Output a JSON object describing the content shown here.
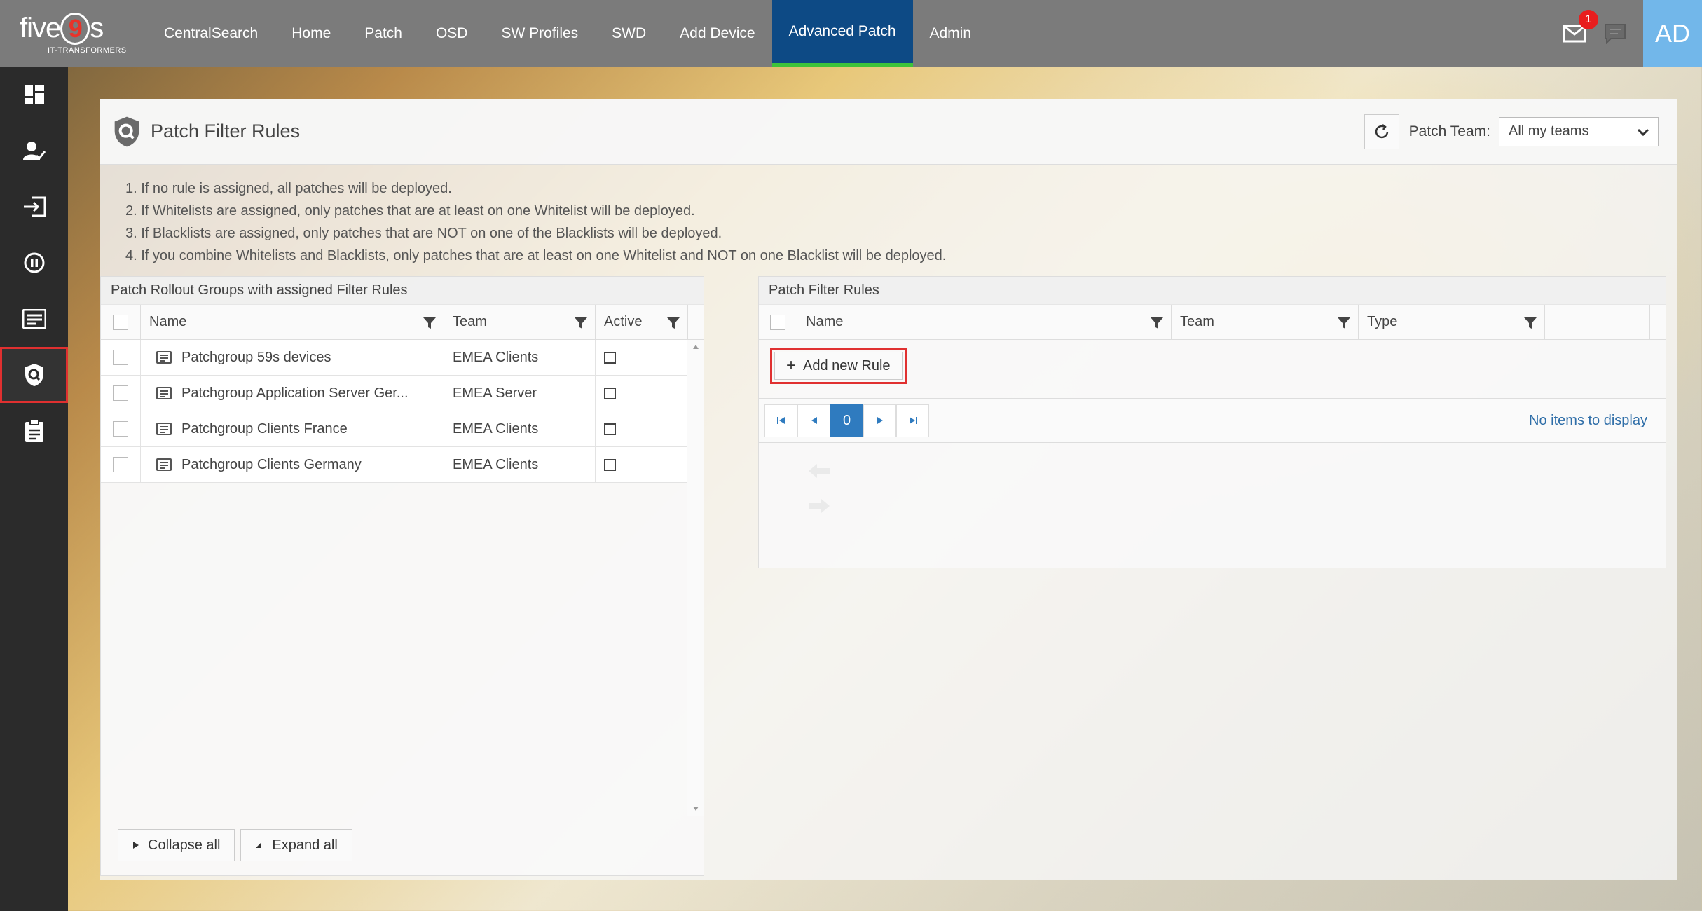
{
  "app": {
    "logo_text": "five",
    "logo_nine": "9",
    "logo_suffix": "s",
    "logo_tagline": "IT-TRANSFORMERS",
    "user_initials": "AD",
    "notification_count": "1"
  },
  "nav": {
    "items": [
      {
        "label": "CentralSearch"
      },
      {
        "label": "Home"
      },
      {
        "label": "Patch"
      },
      {
        "label": "OSD"
      },
      {
        "label": "SW Profiles"
      },
      {
        "label": "SWD"
      },
      {
        "label": "Add Device"
      },
      {
        "label": "Advanced Patch",
        "active": true
      },
      {
        "label": "Admin"
      }
    ]
  },
  "sidebar": {
    "items": [
      {
        "icon": "dashboard-icon"
      },
      {
        "icon": "user-check-icon"
      },
      {
        "icon": "login-icon"
      },
      {
        "icon": "pause-circle-icon"
      },
      {
        "icon": "list-icon"
      },
      {
        "icon": "shield-search-icon",
        "active": true
      },
      {
        "icon": "clipboard-icon"
      }
    ]
  },
  "page": {
    "title": "Patch Filter Rules",
    "team_label": "Patch Team:",
    "team_value": "All my teams",
    "rules": [
      "1. If no rule is assigned, all patches will be deployed.",
      "2. If Whitelists are assigned, only patches that are at least on one Whitelist will be deployed.",
      "3. If Blacklists are assigned, only patches that are NOT on one of the Blacklists will be deployed.",
      "4. If you combine Whitelists and Blacklists, only patches that are at least on one Whitelist and NOT on one Blacklist will be deployed."
    ]
  },
  "left_grid": {
    "title": "Patch Rollout Groups with assigned Filter Rules",
    "columns": [
      "Name",
      "Team",
      "Active"
    ],
    "rows": [
      {
        "name": "Patchgroup 59s devices",
        "team": "EMEA Clients"
      },
      {
        "name": "Patchgroup Application Server Ger...",
        "team": "EMEA Server"
      },
      {
        "name": "Patchgroup Clients France",
        "team": "EMEA Clients"
      },
      {
        "name": "Patchgroup Clients Germany",
        "team": "EMEA Clients"
      }
    ],
    "collapse_label": "Collapse all",
    "expand_label": "Expand all"
  },
  "right_grid": {
    "title": "Patch Filter Rules",
    "columns": [
      "Name",
      "Team",
      "Type"
    ],
    "add_rule_label": "Add new Rule",
    "page_number": "0",
    "empty_text": "No items to display"
  },
  "colors": {
    "topbar": "#7b7b7b",
    "nav_active": "#0d4a85",
    "nav_active_underline": "#3ec33a",
    "sidebar": "#2b2b2b",
    "highlight": "#e03030",
    "pager_active": "#2f7bbf"
  }
}
